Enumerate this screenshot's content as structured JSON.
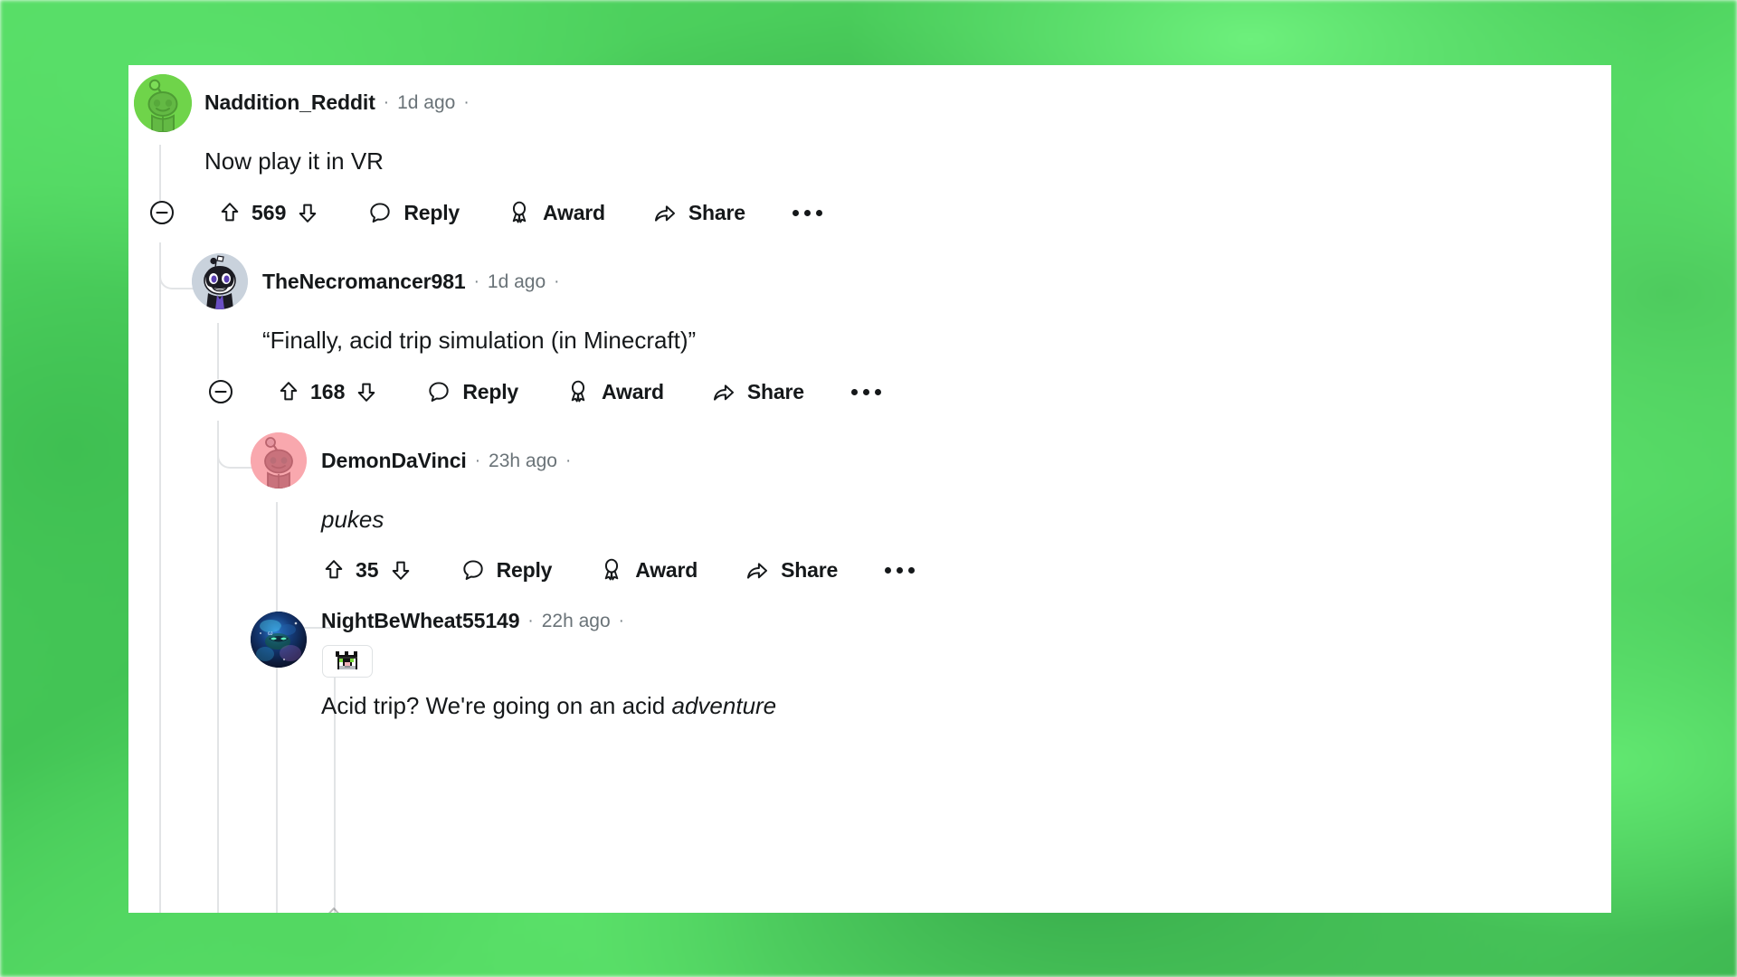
{
  "background": {
    "accent_green": "#4ecb5e",
    "card_bg": "#ffffff"
  },
  "thread": {
    "comments": [
      {
        "id": "c1",
        "username": "Naddition_Reddit",
        "timestamp": "1d ago",
        "body": "Now play it in VR",
        "score": "569",
        "reply_label": "Reply",
        "award_label": "Award",
        "share_label": "Share",
        "collapse_icon": "minus-circle-icon",
        "upvote_icon": "upvote-arrow-icon",
        "downvote_icon": "downvote-arrow-icon",
        "reply_icon": "comment-bubble-icon",
        "award_icon": "award-ribbon-icon",
        "share_icon": "share-arrow-icon",
        "more_icon": "ellipsis-icon",
        "avatar_type": "snoo-green",
        "avatar_colors": {
          "bg": "#6fd44a",
          "body": "#63b944"
        },
        "has_collapse": true,
        "has_more": true,
        "flair": null
      },
      {
        "id": "c2",
        "username": "TheNecromancer981",
        "timestamp": "1d ago",
        "body": "“Finally, acid trip simulation (in Minecraft)”",
        "score": "168",
        "reply_label": "Reply",
        "award_label": "Award",
        "share_label": "Share",
        "collapse_icon": "minus-circle-icon",
        "upvote_icon": "upvote-arrow-icon",
        "downvote_icon": "downvote-arrow-icon",
        "reply_icon": "comment-bubble-icon",
        "award_icon": "award-ribbon-icon",
        "share_icon": "share-arrow-icon",
        "more_icon": "ellipsis-icon",
        "avatar_type": "skull-jester",
        "avatar_colors": {
          "bg": "#c9d2dc",
          "accent": "#5a3fb0"
        },
        "has_collapse": true,
        "has_more": true,
        "flair": null
      },
      {
        "id": "c3",
        "username": "DemonDaVinci",
        "timestamp": "23h ago",
        "body": "pukes",
        "body_italic": true,
        "score": "35",
        "reply_label": "Reply",
        "award_label": "Award",
        "share_label": "Share",
        "upvote_icon": "upvote-arrow-icon",
        "downvote_icon": "downvote-arrow-icon",
        "reply_icon": "comment-bubble-icon",
        "award_icon": "award-ribbon-icon",
        "share_icon": "share-arrow-icon",
        "more_icon": "ellipsis-icon",
        "avatar_type": "snoo-pink",
        "avatar_colors": {
          "bg": "#f9a8ae",
          "body": "#c9727c"
        },
        "has_collapse": false,
        "has_more": true,
        "flair": null
      },
      {
        "id": "c4",
        "username": "NightBeWheat55149",
        "timestamp": "22h ago",
        "body_prefix": "Acid trip? We're going on an acid ",
        "body_italic_word": "adventure",
        "avatar_type": "cosmic-dark",
        "avatar_colors": {
          "bg": "#0e1733",
          "accent": "#2fc8e0"
        },
        "has_collapse": false,
        "has_more": false,
        "flair": {
          "icon": "minecraft-creature-pixel-icon",
          "label": ""
        }
      }
    ]
  }
}
